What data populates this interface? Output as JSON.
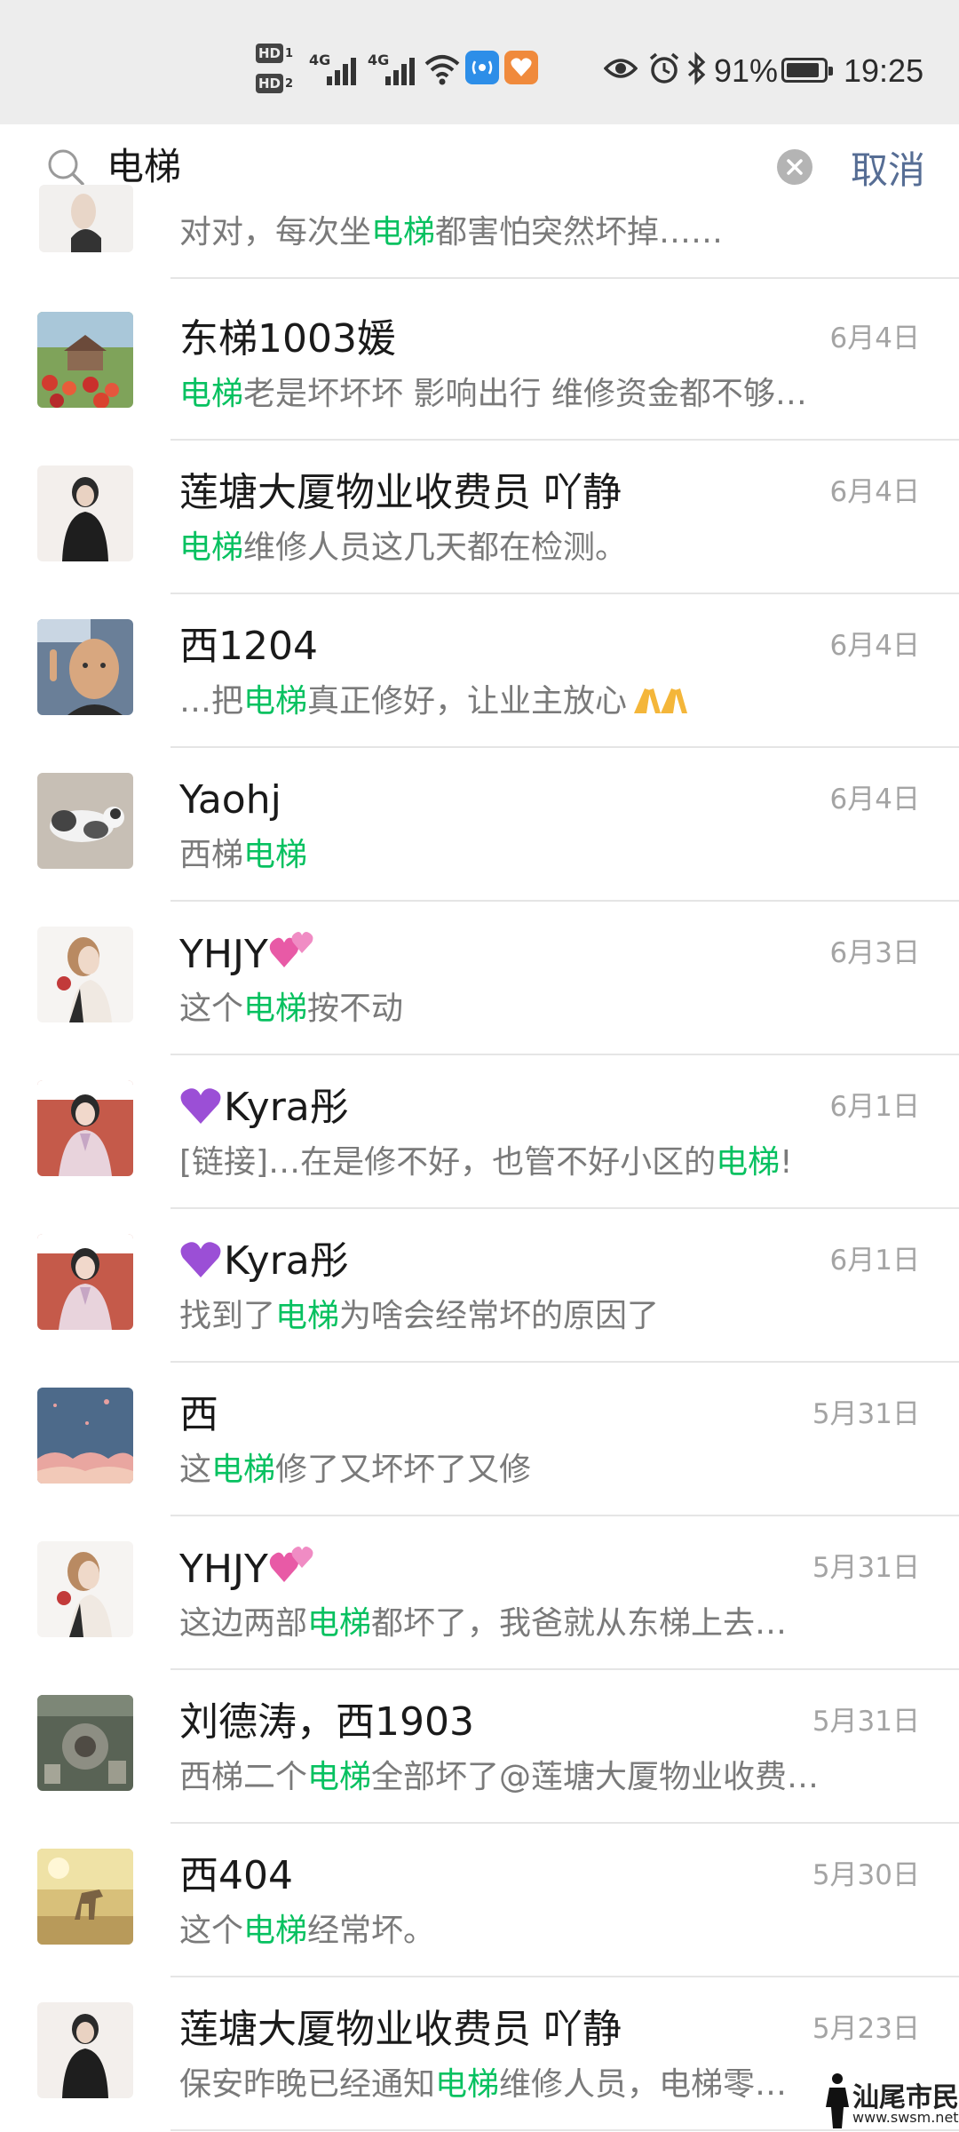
{
  "status_bar": {
    "hd1": "HD",
    "hd1_num": "1",
    "hd2": "HD",
    "hd2_num": "2",
    "net1": "4G",
    "net2": "4G",
    "battery_percent": "91%",
    "battery_level": 0.91,
    "time": "19:25",
    "icons": [
      "signal-icon",
      "wifi-icon",
      "hotspot-app-icon",
      "health-app-icon",
      "eye-icon",
      "alarm-icon",
      "bluetooth-icon",
      "battery-icon"
    ]
  },
  "search": {
    "query": "电梯",
    "cancel_label": "取消"
  },
  "colors": {
    "highlight": "#07c160",
    "cancel": "#566d94",
    "date": "#a4a4a4"
  },
  "partial_result": {
    "snippet": [
      {
        "t": "对对，每次坐"
      },
      {
        "t": "电梯",
        "hl": true
      },
      {
        "t": "都害怕突然坏掉……"
      }
    ]
  },
  "results": [
    {
      "name": "东梯1003媛",
      "date": "6月4日",
      "avatar": "garden-avatar",
      "snippet": [
        {
          "t": "电梯",
          "hl": true
        },
        {
          "t": "老是坏坏坏 影响出行 维修资金都不够…"
        }
      ]
    },
    {
      "name": "莲塘大厦物业收费员  吖静",
      "date": "6月4日",
      "avatar": "woman-black-avatar",
      "snippet": [
        {
          "t": "电梯",
          "hl": true
        },
        {
          "t": "维修人员这几天都在检测。"
        }
      ]
    },
    {
      "name": "西1204",
      "date": "6月4日",
      "avatar": "man-pointing-avatar",
      "snippet": [
        {
          "t": "…把"
        },
        {
          "t": "电梯",
          "hl": true
        },
        {
          "t": "真正修好，让业主放心"
        }
      ],
      "emoji": "praying-hands-emoji"
    },
    {
      "name": "Yaohj",
      "date": "6月4日",
      "avatar": "cat-avatar",
      "snippet": [
        {
          "t": "西梯"
        },
        {
          "t": "电梯",
          "hl": true
        }
      ]
    },
    {
      "name": "YHJY",
      "date": "6月3日",
      "avatar": "girl-side-avatar",
      "name_suffix": "hearts-emoji",
      "snippet": [
        {
          "t": "这个"
        },
        {
          "t": "电梯",
          "hl": true
        },
        {
          "t": "按不动"
        }
      ]
    },
    {
      "name": "Kyra彤",
      "date": "6月1日",
      "avatar": "woman-hanbok-avatar",
      "name_prefix": "purple-heart-emoji",
      "snippet": [
        {
          "t": "[链接]…在是修不好，也管不好小区的"
        },
        {
          "t": "电梯",
          "hl": true
        },
        {
          "t": "!"
        }
      ]
    },
    {
      "name": "Kyra彤",
      "date": "6月1日",
      "avatar": "woman-hanbok-avatar",
      "name_prefix": "purple-heart-emoji",
      "snippet": [
        {
          "t": "找到了"
        },
        {
          "t": "电梯",
          "hl": true
        },
        {
          "t": "为啥会经常坏的原因了"
        }
      ]
    },
    {
      "name": "西",
      "date": "5月31日",
      "avatar": "blue-illustration-avatar",
      "snippet": [
        {
          "t": "这"
        },
        {
          "t": "电梯",
          "hl": true
        },
        {
          "t": "修了又坏坏了又修"
        }
      ]
    },
    {
      "name": "YHJY",
      "date": "5月31日",
      "avatar": "girl-side-avatar",
      "name_suffix": "hearts-emoji",
      "snippet": [
        {
          "t": "这边两部"
        },
        {
          "t": "电梯",
          "hl": true
        },
        {
          "t": "都坏了，我爸就从东梯上去…"
        }
      ]
    },
    {
      "name": "刘德涛，西1903",
      "date": "5月31日",
      "avatar": "aerial-city-avatar",
      "snippet": [
        {
          "t": "西梯二个"
        },
        {
          "t": "电梯",
          "hl": true
        },
        {
          "t": "全部坏了@莲塘大厦物业收费…"
        }
      ]
    },
    {
      "name": "西404",
      "date": "5月30日",
      "avatar": "horse-sunset-avatar",
      "snippet": [
        {
          "t": "这个"
        },
        {
          "t": "电梯",
          "hl": true
        },
        {
          "t": "经常坏。"
        }
      ]
    },
    {
      "name": "莲塘大厦物业收费员  吖静",
      "date": "5月23日",
      "avatar": "woman-black-avatar",
      "snippet": [
        {
          "t": "保安昨晚已经通知"
        },
        {
          "t": "电梯",
          "hl": true
        },
        {
          "t": "维修人员，电梯零…"
        }
      ]
    }
  ],
  "watermark": {
    "text": "汕尾市民网",
    "url": "www.swsm.net"
  }
}
